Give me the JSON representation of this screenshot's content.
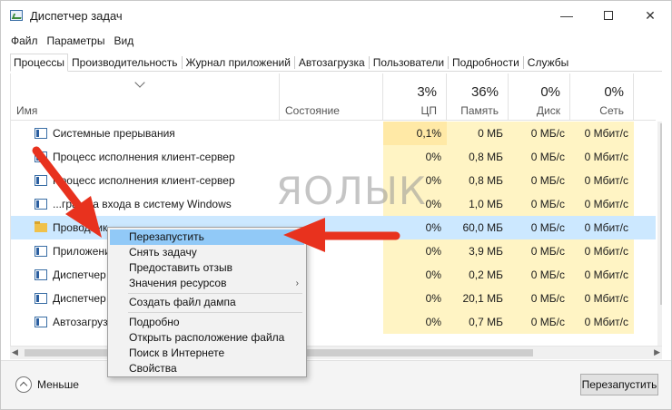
{
  "window": {
    "title": "Диспетчер задач",
    "controls": {
      "minimize": "—",
      "close": "✕"
    }
  },
  "menu": [
    "Файл",
    "Параметры",
    "Вид"
  ],
  "tabs": [
    "Процессы",
    "Производительность",
    "Журнал приложений",
    "Автозагрузка",
    "Пользователи",
    "Подробности",
    "Службы"
  ],
  "columns": {
    "name": "Имя",
    "status": "Состояние",
    "cpu": {
      "pct": "3%",
      "label": "ЦП"
    },
    "memory": {
      "pct": "36%",
      "label": "Память"
    },
    "disk": {
      "pct": "0%",
      "label": "Диск"
    },
    "network": {
      "pct": "0%",
      "label": "Сеть"
    }
  },
  "rows": [
    {
      "name": "Системные прерывания",
      "cpu": "0,1%",
      "mem": "0 МБ",
      "disk": "0 МБ/с",
      "net": "0 Мбит/с"
    },
    {
      "name": "Процесс исполнения клиент-сервер",
      "cpu": "0%",
      "mem": "0,8 МБ",
      "disk": "0 МБ/с",
      "net": "0 Мбит/с"
    },
    {
      "name": "Процесс исполнения клиент-сервер",
      "cpu": "0%",
      "mem": "0,8 МБ",
      "disk": "0 МБ/с",
      "net": "0 Мбит/с"
    },
    {
      "name": "...грамма входа в систему Windows",
      "cpu": "0%",
      "mem": "1,0 МБ",
      "disk": "0 МБ/с",
      "net": "0 Мбит/с"
    },
    {
      "name": "Проводник",
      "cpu": "0%",
      "mem": "60,0 МБ",
      "disk": "0 МБ/с",
      "net": "0 Мбит/с"
    },
    {
      "name": "Приложени",
      "cpu": "0%",
      "mem": "3,9 МБ",
      "disk": "0 МБ/с",
      "net": "0 Мбит/с"
    },
    {
      "name": "Диспетчер с",
      "cpu": "0%",
      "mem": "0,2 МБ",
      "disk": "0 МБ/с",
      "net": "0 Мбит/с"
    },
    {
      "name": "Диспетчер с",
      "cpu": "0%",
      "mem": "20,1 МБ",
      "disk": "0 МБ/с",
      "net": "0 Мбит/с"
    },
    {
      "name": "Автозагрузч",
      "cpu": "0%",
      "mem": "0,7 МБ",
      "disk": "0 МБ/с",
      "net": "0 Мбит/с"
    }
  ],
  "context_menu": {
    "restart": "Перезапустить",
    "end_task": "Снять задачу",
    "feedback": "Предоставить отзыв",
    "resource_values": "Значения ресурсов",
    "dump": "Создать файл дампа",
    "details": "Подробно",
    "open_location": "Открыть расположение файла",
    "search_web": "Поиск в Интернете",
    "properties": "Свойства"
  },
  "footer": {
    "less": "Меньше",
    "restart_button": "Перезапустить"
  },
  "watermark": "ЯОЛЫК",
  "colors": {
    "selection": "#cce8ff",
    "menu_highlight": "#91c9f7",
    "heat": "#fff4c4",
    "annotation_arrow": "#e8321e"
  }
}
